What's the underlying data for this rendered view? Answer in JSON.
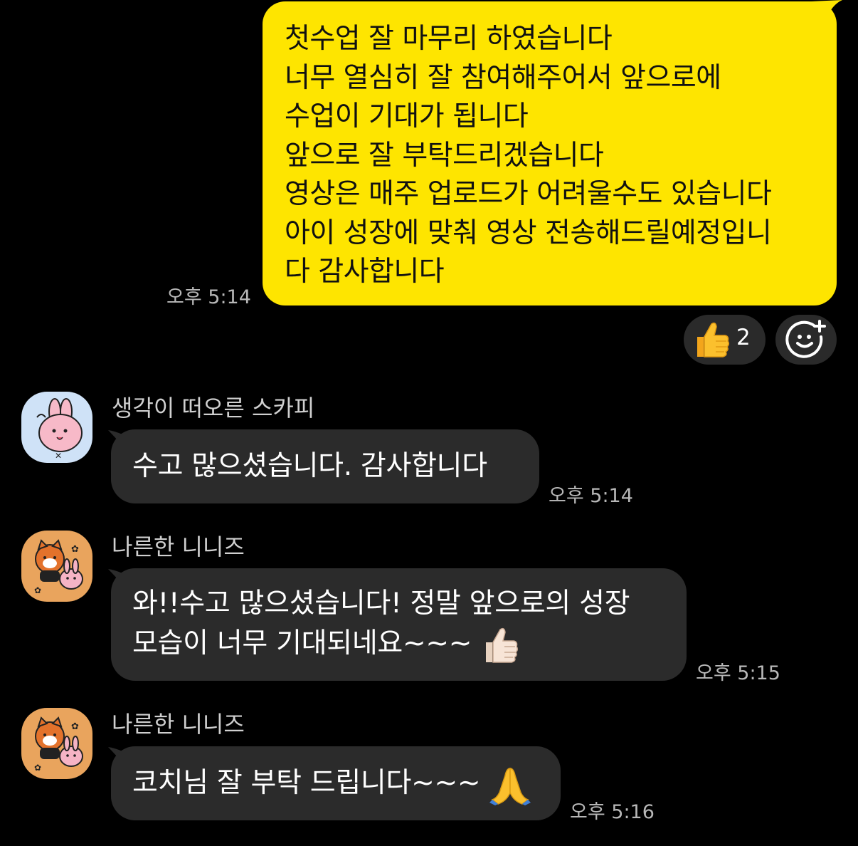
{
  "messages": {
    "mine": {
      "lines": [
        "첫수업 잘 마무리 하였습니다",
        "너무 열심히 잘 참여해주어서  앞으로에",
        "수업이 기대가 됩니다",
        "앞으로 잘 부탁드리겠습니다",
        "영상은 매주 업로드가 어려울수도 있습니다",
        "아이 성장에 맞춰 영상 전송해드릴예정입니",
        "다 감사합니다"
      ],
      "time": "오후 5:14",
      "reaction": {
        "icon": "thumbs-up-icon",
        "count": "2"
      },
      "add_reaction_icon": "add-emoji-icon"
    },
    "msg1": {
      "sender": "생각이 떠오른 스카피",
      "text": "수고 많으셨습니다. 감사합니다",
      "time": "오후 5:14"
    },
    "msg2": {
      "sender": "나른한 니니즈",
      "line1": "와!!수고 많으셨습니다! 정말 앞으로의 성장",
      "line2": "모습이 너무 기대되네요~~~",
      "emoji": "thumbs-up-icon",
      "time": "오후 5:15"
    },
    "msg3": {
      "sender": "나른한 니니즈",
      "text": "코치님 잘 부탁 드립니다~~~",
      "emoji": "folded-hands-icon",
      "time": "오후 5:16"
    }
  },
  "colors": {
    "background": "#000000",
    "my_bubble": "#FEE500",
    "other_bubble": "#2B2B2B",
    "time_text": "#B8B8B8"
  }
}
